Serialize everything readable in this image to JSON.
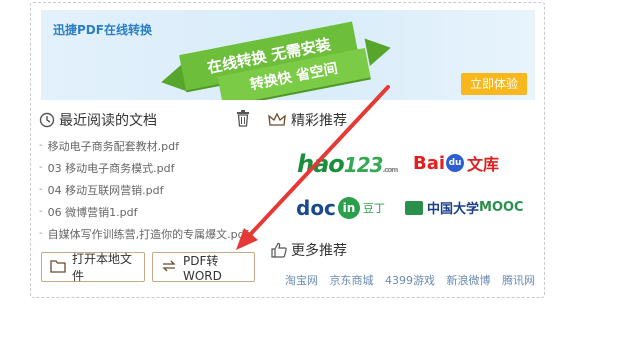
{
  "banner": {
    "title": "迅捷PDF在线转换",
    "slogan_line1": "在线转换 无需安装",
    "slogan_line2": "转换快 省空间",
    "try_button": "立即体验"
  },
  "recent": {
    "heading": "最近阅读的文档",
    "docs": [
      "移动电子商务配套教材.pdf",
      "03 移动电子商务模式.pdf",
      "04 移动互联网营销.pdf",
      "06 微博营销1.pdf",
      "自媒体写作训练营,打造你的专属爆文.pdf"
    ],
    "open_button": "打开本地文件",
    "convert_button": "PDF转WORD"
  },
  "recommend": {
    "heading": "精彩推荐",
    "logos": {
      "hao123": {
        "hao": "hao",
        "num": "123",
        "sub": ".com"
      },
      "baidu": {
        "bai": "Bai",
        "du": "du",
        "wenku": "文库"
      },
      "docin": {
        "doc": "doc",
        "in": "in",
        "cn": "豆丁"
      },
      "mooc": {
        "cn": "中国大学",
        "en": "MOOC"
      }
    },
    "more_heading": "更多推荐",
    "more_links": [
      "淘宝网",
      "京东商城",
      "4399游戏",
      "新浪微博",
      "腾讯网"
    ]
  },
  "colors": {
    "accent_green": "#6dbf3b",
    "try_button": "#f8b81d",
    "annotation_arrow": "#e53935"
  }
}
